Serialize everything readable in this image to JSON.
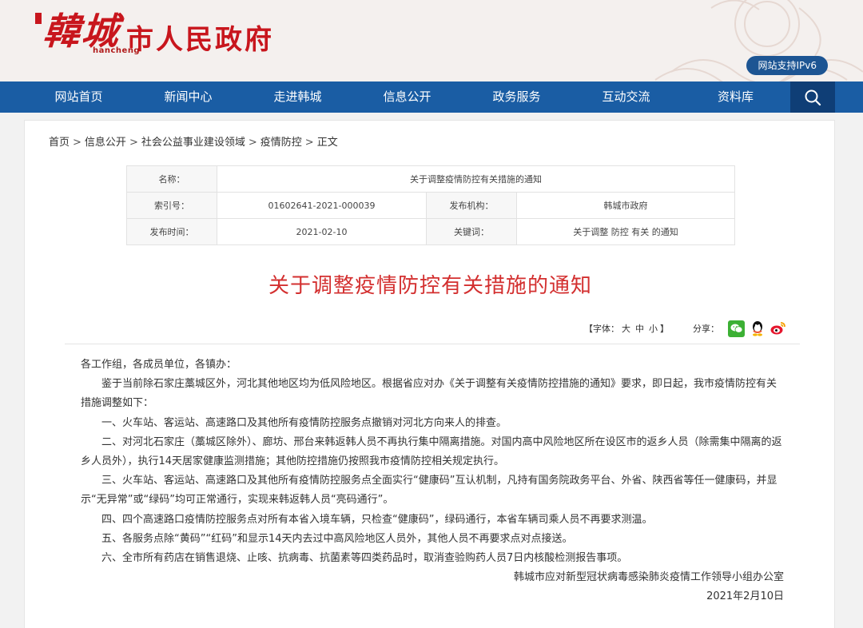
{
  "header": {
    "logo_brush": "韓城",
    "logo_pinyin": "hancheng",
    "logo_gov": "市人民政府",
    "ipv6_label": "网站支持IPv6"
  },
  "nav": {
    "items": [
      "网站首页",
      "新闻中心",
      "走进韩城",
      "信息公开",
      "政务服务",
      "互动交流",
      "资料库"
    ],
    "search_icon": "search-icon"
  },
  "breadcrumb": [
    "首页",
    "信息公开",
    "社会公益事业建设领域",
    "疫情防控",
    "正文"
  ],
  "breadcrumb_sep": ">",
  "meta": {
    "name_label": "名称：",
    "name_value": "关于调整疫情防控有关措施的通知",
    "index_label": "索引号：",
    "index_value": "01602641-2021-000039",
    "org_label": "发布机构：",
    "org_value": "韩城市政府",
    "date_label": "发布时间：",
    "date_value": "2021-02-10",
    "keyword_label": "关键词：",
    "keyword_value": "关于调整 防控 有关 的通知"
  },
  "article": {
    "title": "关于调整疫情防控有关措施的通知",
    "font_label": "【字体：",
    "font_sizes": [
      "大",
      "中",
      "小"
    ],
    "font_close": "】",
    "share_label": "分享：",
    "share_icons": [
      "wechat-icon",
      "qq-icon",
      "weibo-icon"
    ],
    "greeting": "各工作组，各成员单位，各镇办：",
    "paragraphs": [
      "鉴于当前除石家庄藁城区外，河北其他地区均为低风险地区。根据省应对办《关于调整有关疫情防控措施的通知》要求，即日起，我市疫情防控有关措施调整如下：",
      "一、火车站、客运站、高速路口及其他所有疫情防控服务点撤销对河北方向来人的排查。",
      "二、对河北石家庄（藁城区除外）、廊坊、邢台来韩返韩人员不再执行集中隔离措施。对国内高中风险地区所在设区市的返乡人员（除需集中隔离的返乡人员外），执行14天居家健康监测措施；其他防控措施仍按照我市疫情防控相关规定执行。",
      "三、火车站、客运站、高速路口及其他所有疫情防控服务点全面实行“健康码”互认机制，凡持有国务院政务平台、外省、陕西省等任一健康码，并显示“无异常”或“绿码”均可正常通行，实现来韩返韩人员“亮码通行”。",
      "四、四个高速路口疫情防控服务点对所有本省入境车辆，只检查“健康码”，绿码通行，本省车辆司乘人员不再要求测温。",
      "五、各服务点除“黄码”“红码”和显示14天内去过中高风险地区人员外，其他人员不再要求点对点接送。",
      "六、全市所有药店在销售退烧、止咳、抗病毒、抗菌素等四类药品时，取消查验购药人员7日内核酸检测报告事项。"
    ],
    "signature": "韩城市应对新型冠状病毒感染肺炎疫情工作领导小组办公室",
    "sign_date": "2021年2月10日"
  },
  "colors": {
    "brand_red": "#c8161d",
    "nav_blue": "#1a5da4",
    "title_red": "#d32f2f"
  }
}
